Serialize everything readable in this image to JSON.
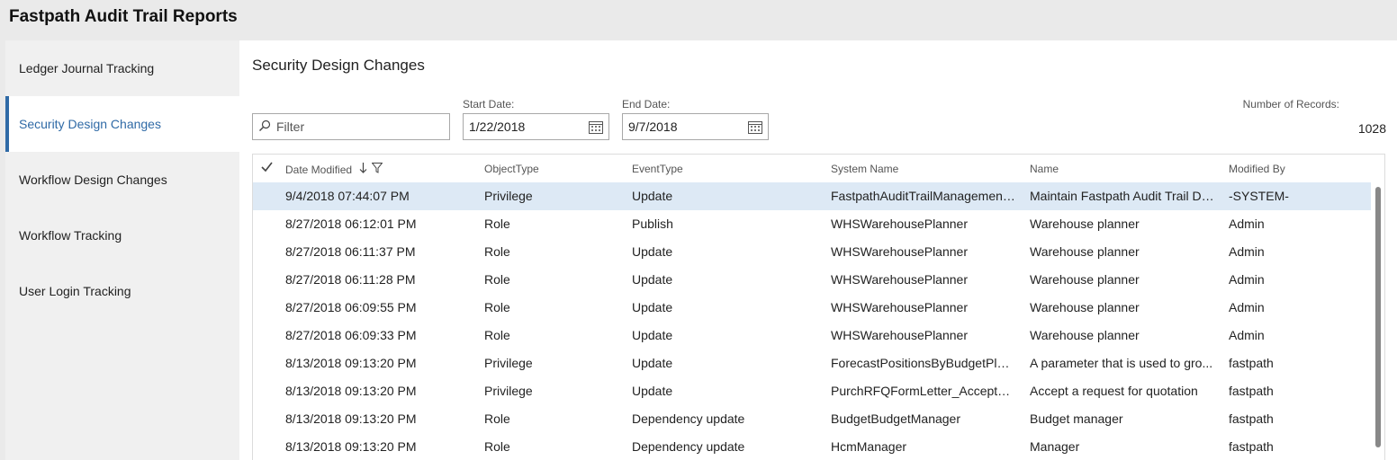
{
  "app": {
    "title": "Fastpath Audit Trail Reports"
  },
  "sidebar": {
    "items": [
      {
        "label": "Ledger Journal Tracking"
      },
      {
        "label": "Security Design Changes"
      },
      {
        "label": "Workflow Design Changes"
      },
      {
        "label": "Workflow Tracking"
      },
      {
        "label": "User Login Tracking"
      }
    ],
    "selected": "Security Design Changes"
  },
  "page": {
    "title": "Security Design Changes"
  },
  "filters": {
    "filter_placeholder": "Filter",
    "start_date_label": "Start Date:",
    "start_date_value": "1/22/2018",
    "end_date_label": "End Date:",
    "end_date_value": "9/7/2018",
    "records_label": "Number of Records:",
    "records_value": "1028"
  },
  "grid": {
    "columns": [
      "Date Modified",
      "ObjectType",
      "EventType",
      "System Name",
      "Name",
      "Modified By"
    ],
    "sort_column": "Date Modified",
    "rows": [
      {
        "date": "9/4/2018 07:44:07 PM",
        "object_type": "Privilege",
        "event_type": "Update",
        "system_name": "FastpathAuditTrailManagement...",
        "name": "Maintain Fastpath Audit Trail Data",
        "modified_by": "-SYSTEM-"
      },
      {
        "date": "8/27/2018 06:12:01 PM",
        "object_type": "Role",
        "event_type": "Publish",
        "system_name": "WHSWarehousePlanner",
        "name": "Warehouse planner",
        "modified_by": "Admin"
      },
      {
        "date": "8/27/2018 06:11:37 PM",
        "object_type": "Role",
        "event_type": "Update",
        "system_name": "WHSWarehousePlanner",
        "name": "Warehouse planner",
        "modified_by": "Admin"
      },
      {
        "date": "8/27/2018 06:11:28 PM",
        "object_type": "Role",
        "event_type": "Update",
        "system_name": "WHSWarehousePlanner",
        "name": "Warehouse planner",
        "modified_by": "Admin"
      },
      {
        "date": "8/27/2018 06:09:55 PM",
        "object_type": "Role",
        "event_type": "Update",
        "system_name": "WHSWarehousePlanner",
        "name": "Warehouse planner",
        "modified_by": "Admin"
      },
      {
        "date": "8/27/2018 06:09:33 PM",
        "object_type": "Role",
        "event_type": "Update",
        "system_name": "WHSWarehousePlanner",
        "name": "Warehouse planner",
        "modified_by": "Admin"
      },
      {
        "date": "8/13/2018 09:13:20 PM",
        "object_type": "Privilege",
        "event_type": "Update",
        "system_name": "ForecastPositionsByBudgetPlan...",
        "name": "A parameter that is used to gro...",
        "modified_by": "fastpath"
      },
      {
        "date": "8/13/2018 09:13:20 PM",
        "object_type": "Privilege",
        "event_type": "Update",
        "system_name": "PurchRFQFormLetter_AcceptPro...",
        "name": "Accept a request for quotation",
        "modified_by": "fastpath"
      },
      {
        "date": "8/13/2018 09:13:20 PM",
        "object_type": "Role",
        "event_type": "Dependency update",
        "system_name": "BudgetBudgetManager",
        "name": "Budget manager",
        "modified_by": "fastpath"
      },
      {
        "date": "8/13/2018 09:13:20 PM",
        "object_type": "Role",
        "event_type": "Dependency update",
        "system_name": "HcmManager",
        "name": "Manager",
        "modified_by": "fastpath"
      }
    ],
    "selected_row": 0
  },
  "colors": {
    "accent": "#2f6aa6",
    "selected_row": "#dde9f5",
    "sidebar_bg": "#f0f0f0",
    "topbar_bg": "#eaeaea"
  },
  "icons": {
    "filter_search": "search-icon",
    "calendar": "calendar-icon",
    "select_all": "checkmark-icon",
    "sort": "sort-down-arrow-icon",
    "column_filter": "funnel-icon"
  }
}
